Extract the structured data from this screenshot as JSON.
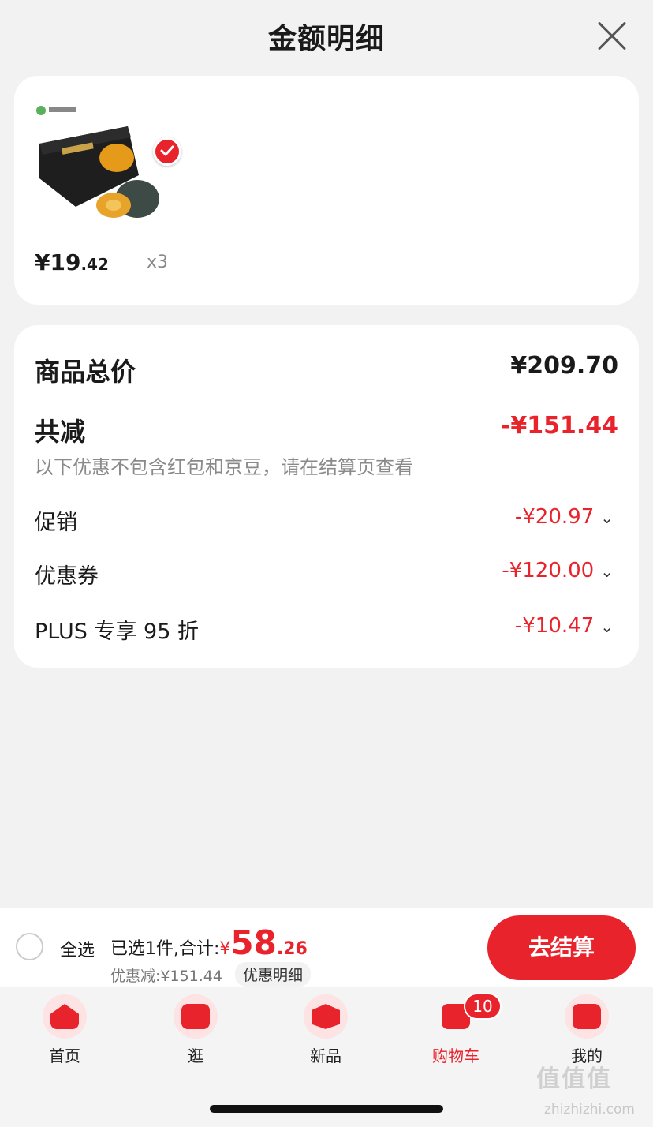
{
  "header": {
    "title": "金额明细",
    "close_icon": "close-icon"
  },
  "product": {
    "price_main": "¥19",
    "price_decimal": ".42",
    "quantity": "x3",
    "selected": true,
    "image_alt": "贝贝南瓜"
  },
  "detail": {
    "total_label": "商品总价",
    "total_value": "¥209.70",
    "reduce_label": "共减",
    "reduce_value": "-¥151.44",
    "note": "以下优惠不包含红包和京豆，请在结算页查看",
    "items": [
      {
        "label": "促销",
        "value": "-¥20.97",
        "icon": "chevron-down-icon"
      },
      {
        "label": "优惠券",
        "value": "-¥120.00",
        "icon": "chevron-down-icon"
      },
      {
        "label": "PLUS 专享 95 折",
        "value": "-¥10.47",
        "icon": "chevron-down-icon"
      }
    ]
  },
  "checkout": {
    "select_all": "全选",
    "selected_text": "已选1件,合计:",
    "yen": "¥",
    "amount_int": "58",
    "amount_dec": ".26",
    "discount_text": "优惠减:¥151.44",
    "detail_link": "优惠明细",
    "button": "去结算"
  },
  "tabbar": {
    "tabs": [
      {
        "label": "首页",
        "icon": "home-icon"
      },
      {
        "label": "逛",
        "icon": "stroll-icon"
      },
      {
        "label": "新品",
        "icon": "new-product-icon"
      },
      {
        "label": "购物车",
        "icon": "cart-icon",
        "badge": "10",
        "active": true
      },
      {
        "label": "我的",
        "icon": "profile-icon"
      }
    ]
  },
  "watermark": {
    "text": "值值值",
    "url": "zhizhizhi.com"
  },
  "colors": {
    "accent": "#e8232b",
    "background": "#f2f2f2",
    "card": "#ffffff",
    "muted": "#8a8a8a"
  }
}
